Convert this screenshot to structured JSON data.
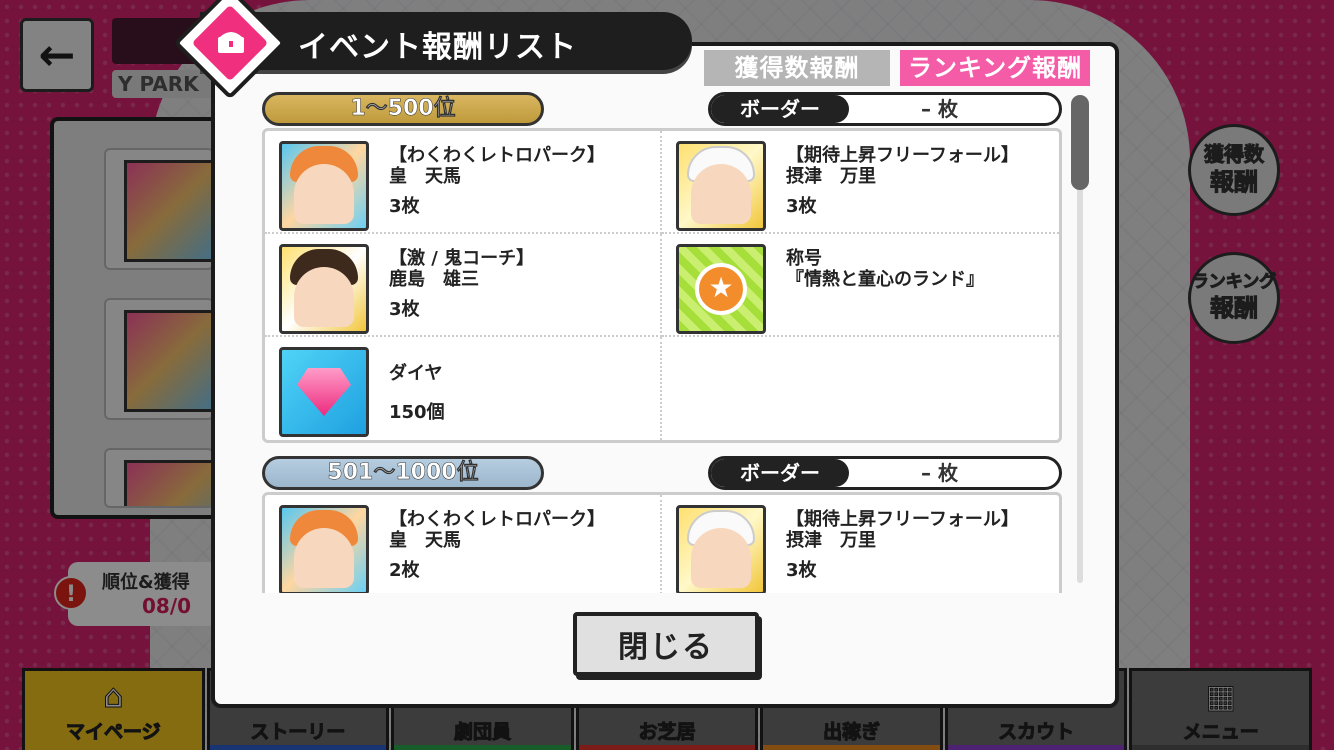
{
  "background": {
    "back_arrow": "←",
    "park_label": "Y PARK",
    "notice_line1": "順位&獲得",
    "notice_line2": "08/0",
    "notice_mark": "!",
    "side_buttons": [
      {
        "line1": "獲得数",
        "line2": "報酬"
      },
      {
        "line1": "ランキング",
        "line2": "報酬"
      }
    ]
  },
  "bottom_nav": [
    {
      "label": "マイページ",
      "icon": "home-icon",
      "glyph": "⌂",
      "strip": "#f3c51f"
    },
    {
      "label": "ストーリー",
      "icon": "",
      "glyph": "",
      "strip": "#2f5fd1"
    },
    {
      "label": "劇団員",
      "icon": "",
      "glyph": "",
      "strip": "#2daa4b"
    },
    {
      "label": "お芝居",
      "icon": "",
      "glyph": "",
      "strip": "#e0332c"
    },
    {
      "label": "出稼ぎ",
      "icon": "",
      "glyph": "",
      "strip": "#ef8a1f"
    },
    {
      "label": "スカウト",
      "icon": "",
      "glyph": "",
      "strip": "#8e3fd0"
    },
    {
      "label": "メニュー",
      "icon": "grid-menu-icon",
      "glyph": "▦",
      "strip": "#555555"
    }
  ],
  "modal": {
    "title": "イベント報酬リスト",
    "tabs": {
      "count_rewards": "獲得数報酬",
      "ranking_rewards": "ランキング報酬"
    },
    "close_label": "閉じる"
  },
  "tiers": [
    {
      "rank": "1〜500位",
      "border_label": "ボーダー",
      "border_value": "– 枚",
      "rewards": [
        {
          "icon": "card-icon",
          "style": "orange",
          "name": "【わくわくレトロパーク】",
          "sub": "皇　天馬",
          "qty": "3枚"
        },
        {
          "icon": "card-icon",
          "style": "white",
          "name": "【期待上昇フリーフォール】",
          "sub": "摂津　万里",
          "qty": "3枚"
        },
        {
          "icon": "card-icon",
          "style": "dark",
          "name": "【激 / 鬼コーチ】",
          "sub": "鹿島　雄三",
          "qty": "3枚"
        },
        {
          "icon": "title-medal-icon",
          "style": "medal",
          "name": "称号",
          "sub": "『情熱と童心のランド』",
          "qty": ""
        },
        {
          "icon": "diamond-icon",
          "style": "diamond",
          "name": "ダイヤ",
          "sub": "",
          "qty": "150個"
        }
      ]
    },
    {
      "rank": "501〜1000位",
      "border_label": "ボーダー",
      "border_value": "– 枚",
      "rewards": [
        {
          "icon": "card-icon",
          "style": "orange",
          "name": "【わくわくレトロパーク】",
          "sub": "皇　天馬",
          "qty": "2枚"
        },
        {
          "icon": "card-icon",
          "style": "white",
          "name": "【期待上昇フリーフォール】",
          "sub": "摂津　万里",
          "qty": "3枚"
        }
      ]
    }
  ],
  "colors": {
    "accent_pink": "#f55ca8",
    "tier1_gold": "#c9a447",
    "tier2_blue": "#a9c2d6"
  }
}
